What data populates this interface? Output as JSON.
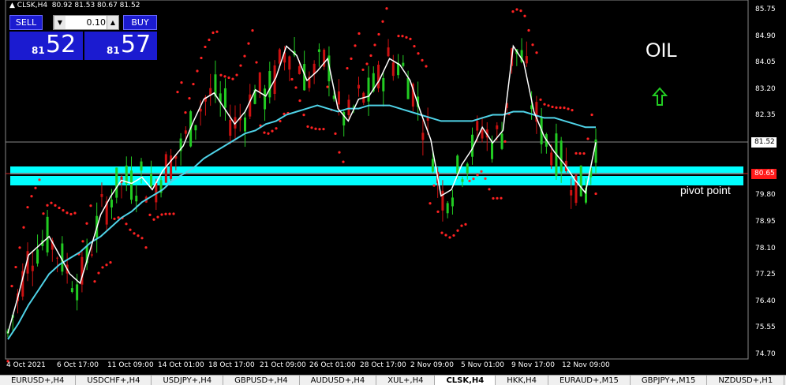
{
  "header": {
    "symbol_info": "CLSK,H4  80.92 81.53 80.67 81.52"
  },
  "trade_panel": {
    "sell_label": "SELL",
    "buy_label": "BUY",
    "lot": "0.10",
    "sell_price_small": "81",
    "sell_price_big": "52",
    "buy_price_small": "81",
    "buy_price_big": "57"
  },
  "annotations": {
    "title": "OIL",
    "pivot": "pivot point",
    "arrow_color": "#22cc22"
  },
  "price_axis": [
    "85.75",
    "84.90",
    "84.05",
    "83.20",
    "82.35",
    "81.52",
    "80.65",
    "79.80",
    "78.95",
    "78.10",
    "77.25",
    "76.40",
    "75.55",
    "74.70"
  ],
  "current_price": "81.52",
  "pivot_price": "80.65",
  "time_axis": [
    "4 Oct 2021",
    "6 Oct 17:00",
    "11 Oct 09:00",
    "14 Oct 01:00",
    "18 Oct 17:00",
    "21 Oct 09:00",
    "26 Oct 01:00",
    "28 Oct 17:00",
    "2 Nov 09:00",
    "5 Nov 01:00",
    "9 Nov 17:00",
    "12 Nov 09:00"
  ],
  "tabs": [
    "EURUSD+,H4",
    "USDCHF+,H4",
    "USDJPY+,H4",
    "GBPUSD+,H4",
    "AUDUSD+,H4",
    "XUL+,H4",
    "CLSK,H4",
    "HKK,H4",
    "EURAUD+,M15",
    "GBPJPY+,M15",
    "NZDUSD+,H1"
  ],
  "active_tab": 6,
  "colors": {
    "bull": "#22cc22",
    "bear": "#cc1111",
    "sar": "#ff2222",
    "fast_ma": "#ffffff",
    "slow_ma": "#4fd3e8",
    "pivot_zone": "#00ffff"
  },
  "chart_data": {
    "type": "line",
    "ylim": [
      74.7,
      85.75
    ],
    "series": [
      {
        "values": [
          75.4,
          76.6,
          77.9,
          78.2,
          78.5,
          77.9,
          77.3,
          77.0,
          78.1,
          79.2,
          79.8,
          80.3,
          80.2,
          80.4,
          80.0,
          80.6,
          81.0,
          81.4,
          82.2,
          82.9,
          83.1,
          82.6,
          82.1,
          82.5,
          83.2,
          83.0,
          83.6,
          84.6,
          84.3,
          83.5,
          83.8,
          84.2,
          82.6,
          82.2,
          82.9,
          83.0,
          83.5,
          84.2,
          84.0,
          83.5,
          82.5,
          81.6,
          79.8,
          80.0,
          80.8,
          81.3,
          82.0,
          81.5,
          81.9,
          84.6,
          84.1,
          82.5,
          81.7,
          81.2,
          80.8,
          80.3,
          79.9,
          81.52
        ]
      },
      {
        "values": [
          75.2,
          75.7,
          76.3,
          76.8,
          77.3,
          77.6,
          77.8,
          78.0,
          78.3,
          78.5,
          78.8,
          79.1,
          79.3,
          79.6,
          79.8,
          80.0,
          80.3,
          80.5,
          80.7,
          81.0,
          81.2,
          81.4,
          81.6,
          81.8,
          81.9,
          82.1,
          82.2,
          82.4,
          82.5,
          82.6,
          82.7,
          82.6,
          82.5,
          82.6,
          82.6,
          82.7,
          82.7,
          82.7,
          82.6,
          82.5,
          82.4,
          82.3,
          82.2,
          82.2,
          82.2,
          82.2,
          82.3,
          82.4,
          82.4,
          82.5,
          82.5,
          82.4,
          82.3,
          82.3,
          82.2,
          82.1,
          82.0,
          82.0
        ]
      }
    ]
  }
}
